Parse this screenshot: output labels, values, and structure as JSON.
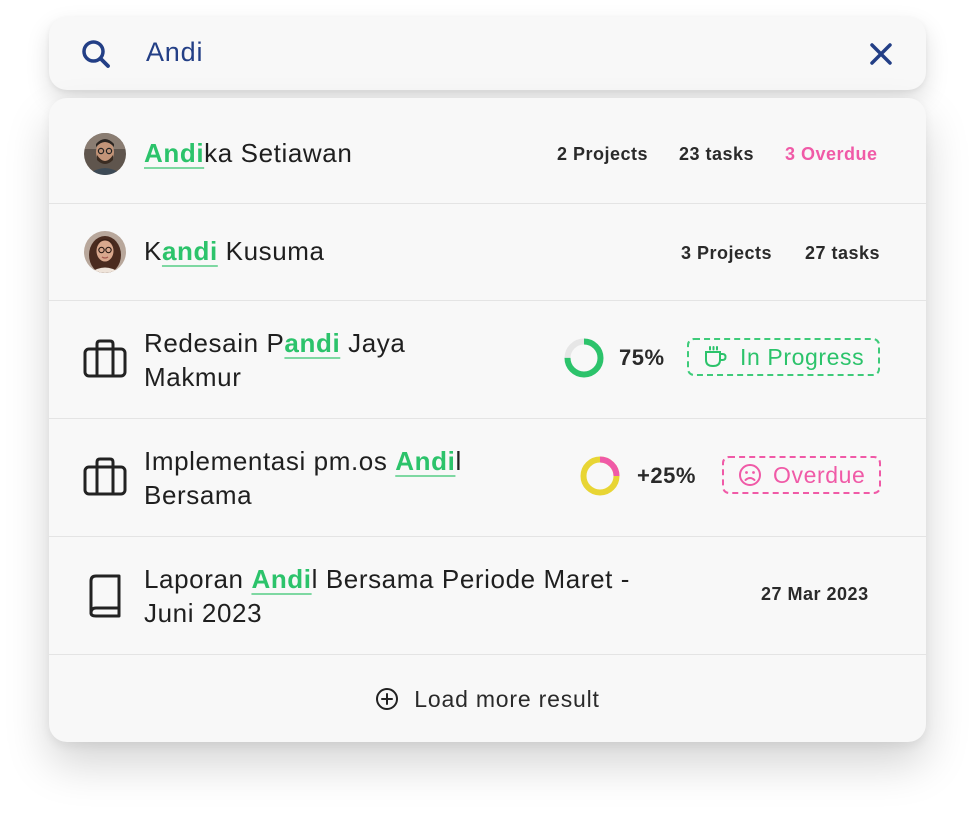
{
  "search": {
    "value": "Andi",
    "icon": "search-icon",
    "clear_icon": "close-icon"
  },
  "results": {
    "people": [
      {
        "name_before": "",
        "name_match": "Andi",
        "name_after": "ka Setiawan",
        "projects": "2 Projects",
        "tasks": "23 tasks",
        "overdue": "3 Overdue"
      },
      {
        "name_before": "K",
        "name_match": "andi",
        "name_after": " Kusuma",
        "projects": "3 Projects",
        "tasks": "27 tasks"
      }
    ],
    "projects": [
      {
        "title_before": "Redesain P",
        "title_match": "andi",
        "title_after": " Jaya",
        "title_line2": "Makmur",
        "progress_text": "75%",
        "progress_value": 0.75,
        "status": "In Progress",
        "status_icon": "coffee-cup-icon"
      },
      {
        "title_before": "Implementasi pm.os ",
        "title_match": "Andi",
        "title_after": "l",
        "title_line2": "Bersama",
        "progress_text": "+25%",
        "progress_value": 0.25,
        "status": "Overdue",
        "status_icon": "sad-face-icon"
      }
    ],
    "document": {
      "title_before": "Laporan ",
      "title_match": "Andi",
      "title_after": "l Bersama Periode Maret -",
      "title_line2": "Juni 2023",
      "date": "27 Mar 2023"
    },
    "load_more": "Load more result"
  },
  "colors": {
    "accent_green": "#2cc36b",
    "overdue_pink": "#f05aa7",
    "search_blue": "#233f86",
    "donut_yellow": "#e8d534",
    "track_gray": "#e6e6e6"
  }
}
